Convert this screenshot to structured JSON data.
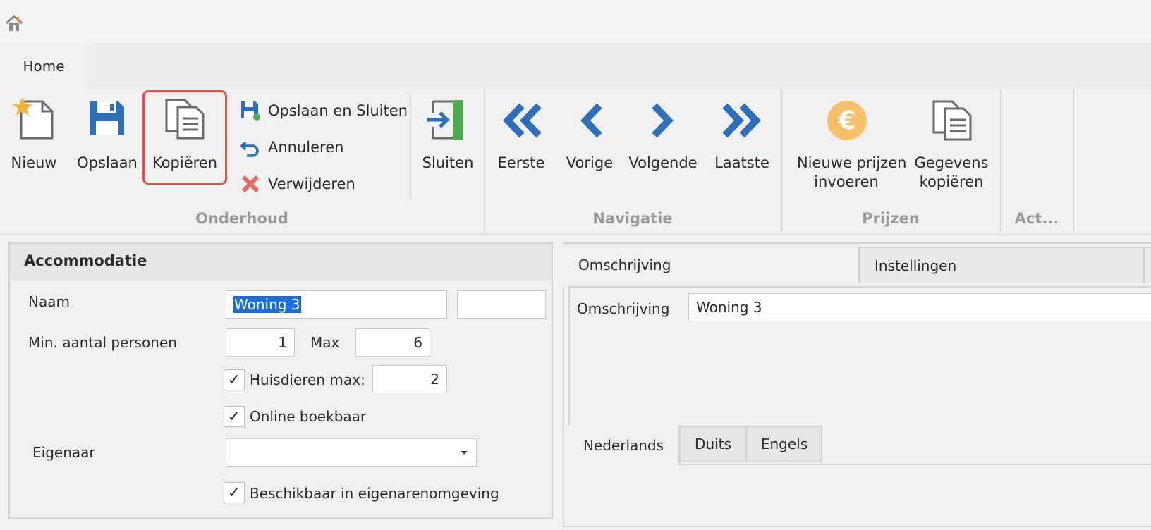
{
  "colors": {
    "accent": "#2f6fb7",
    "highlight": "#d9534f",
    "euro": "#f5c16c"
  },
  "tabs": [
    {
      "label": "Home"
    }
  ],
  "ribbon": {
    "onderhoud": {
      "group_label": "Onderhoud",
      "nieuw": "Nieuw",
      "opslaan": "Opslaan",
      "kopieren": "Kopiëren",
      "opslaan_sluiten": "Opslaan en Sluiten",
      "annuleren": "Annuleren",
      "verwijderen": "Verwijderen",
      "sluiten": "Sluiten"
    },
    "navigatie": {
      "group_label": "Navigatie",
      "eerste": "Eerste",
      "vorige": "Vorige",
      "volgende": "Volgende",
      "laatste": "Laatste"
    },
    "prijzen": {
      "group_label": "Prijzen",
      "nieuwe_prijzen_1": "Nieuwe prijzen",
      "nieuwe_prijzen_2": "invoeren",
      "gegevens_kopieren_1": "Gegevens",
      "gegevens_kopieren_2": "kopiëren"
    },
    "act": {
      "group_label": "Act..."
    }
  },
  "form": {
    "title": "Accommodatie",
    "naam_label": "Naam",
    "naam_value": "Woning 3",
    "naam_extra_value": "",
    "min_label": "Min. aantal personen",
    "min_value": "1",
    "max_label": "Max",
    "max_value": "6",
    "huisdieren_label": "Huisdieren max:",
    "huisdieren_checked": "✓",
    "huisdieren_value": "2",
    "online_label": "Online boekbaar",
    "online_checked": "✓",
    "eigenaar_label": "Eigenaar",
    "eigenaar_value": "",
    "beschikbaar_label": "Beschikbaar in eigenarenomgeving",
    "beschikbaar_checked": "✓"
  },
  "detail": {
    "tabs": [
      "Omschrijving",
      "Instellingen"
    ],
    "omschrijving_label": "Omschrijving",
    "omschrijving_value": "Woning 3",
    "lang_tabs": [
      "Nederlands",
      "Duits",
      "Engels"
    ]
  }
}
